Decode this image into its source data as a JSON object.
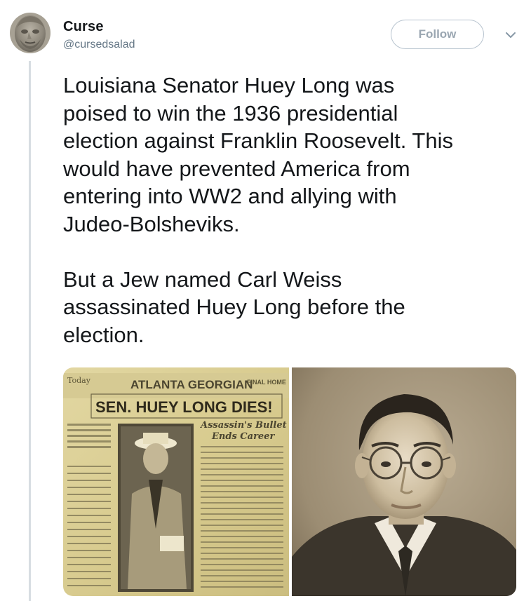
{
  "tweet": {
    "display_name": "Curse",
    "handle": "@cursedsalad",
    "follow_label": "Follow",
    "paragraphs": [
      "Louisiana Senator Huey Long was\npoised to win the 1936 presidential\nelection against Franklin Roosevelt. This\nwould have prevented America from\nentering into WW2 and allying with\nJudeo-Bolsheviks.",
      "But a Jew named Carl Weiss\nassassinated Huey Long before the\nelection."
    ]
  },
  "newspaper": {
    "today": "Today",
    "masthead": "ATLANTA GEORGIAN",
    "edition": "FINAL HOME",
    "headline": "SEN. HUEY LONG DIES!",
    "subhead_1": "Assassin's Bullet",
    "subhead_2": "Ends Career"
  },
  "colors": {
    "text": "#14171a",
    "secondary": "#657786",
    "thread_line": "#d7dde2",
    "follow_border": "#b8c4cf",
    "follow_text": "#9aa6b1"
  },
  "icons": {
    "menu": "chevron-down-icon"
  }
}
